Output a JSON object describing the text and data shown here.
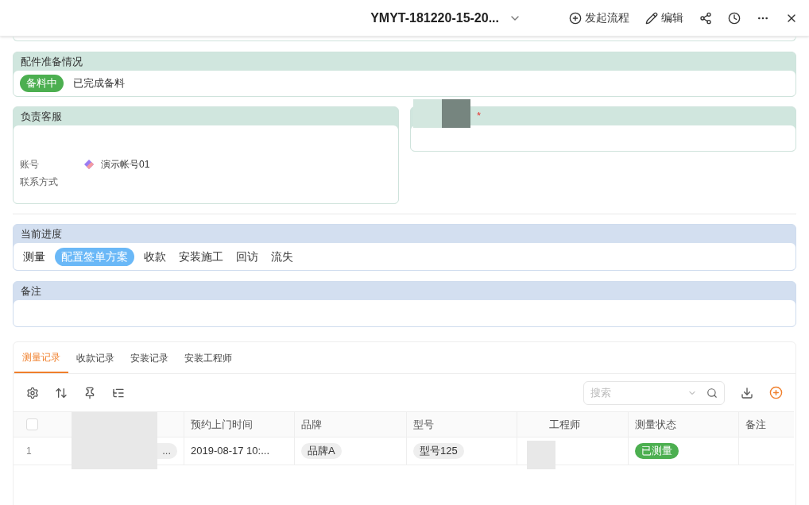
{
  "header": {
    "title": "YMYT-181220-15-20...",
    "actions": [
      {
        "kind": "flow",
        "label": "发起流程"
      },
      {
        "kind": "edit",
        "label": "编辑"
      },
      {
        "kind": "share"
      },
      {
        "kind": "history"
      },
      {
        "kind": "more"
      },
      {
        "kind": "close"
      }
    ]
  },
  "parts_prep": {
    "title": "配件准备情况",
    "options": [
      {
        "label": "备料中",
        "selected": true
      },
      {
        "label": "已完成备料",
        "selected": false
      }
    ]
  },
  "service": {
    "title": "负责客服",
    "fields": [
      {
        "label": "账号",
        "value": "演示帐号01"
      },
      {
        "label": "联系方式"
      }
    ]
  },
  "engineer_card": {
    "required_mark": "*"
  },
  "progress": {
    "title": "当前进度",
    "steps": [
      {
        "label": "测量",
        "selected": false
      },
      {
        "label": "配置签单方案",
        "selected": true
      },
      {
        "label": "收款",
        "selected": false
      },
      {
        "label": "安装施工",
        "selected": false
      },
      {
        "label": "回访",
        "selected": false
      },
      {
        "label": "流失",
        "selected": false
      }
    ]
  },
  "remark": {
    "title": "备注"
  },
  "records": {
    "tabs": [
      {
        "label": "测量记录",
        "selected": true
      },
      {
        "label": "收款记录",
        "selected": false
      },
      {
        "label": "安装记录",
        "selected": false
      },
      {
        "label": "安装工程师",
        "selected": false
      }
    ],
    "search": {
      "placeholder": "搜索"
    },
    "select_all": {
      "checked": false
    },
    "columns": [
      "",
      "预约上门时间",
      "品牌",
      "型号",
      "工程师",
      "测量状态",
      "备注"
    ],
    "rows": [
      {
        "index": "1",
        "name": "...",
        "time": "2019-08-17 10:...",
        "brand": "品牌A",
        "model": "型号125",
        "engineer": "",
        "status": "已测量",
        "remark": ""
      }
    ]
  }
}
